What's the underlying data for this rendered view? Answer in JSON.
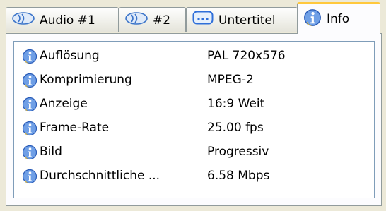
{
  "tabs": [
    {
      "label": "Audio #1",
      "icon": "speaker-icon"
    },
    {
      "label": "#2",
      "icon": "speaker-icon"
    },
    {
      "label": "Untertitel",
      "icon": "subtitle-icon"
    },
    {
      "label": "Info",
      "icon": "info-icon",
      "active": true
    }
  ],
  "info": {
    "rows": [
      {
        "name": "Auflösung",
        "value": "PAL 720x576"
      },
      {
        "name": "Komprimierung",
        "value": "MPEG-2"
      },
      {
        "name": "Anzeige",
        "value": "16:9 Weit"
      },
      {
        "name": "Frame-Rate",
        "value": "25.00 fps"
      },
      {
        "name": "Bild",
        "value": "Progressiv"
      },
      {
        "name": "Durchschnittliche ...",
        "value": "6.58 Mbps"
      }
    ]
  },
  "colors": {
    "accent_tab_border": "#ffc83c",
    "icon_blue": "#2f6fd9",
    "panel_border": "#919b9c",
    "list_border": "#7f9db9"
  }
}
